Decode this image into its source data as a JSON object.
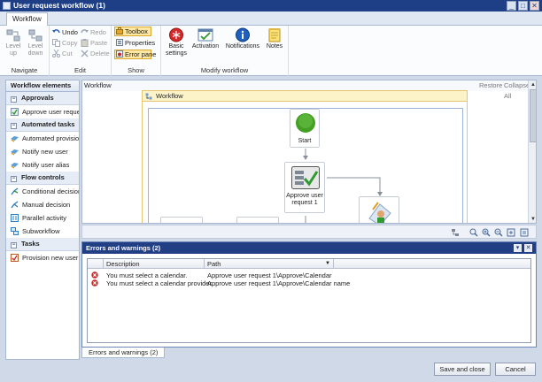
{
  "window": {
    "title": "User request workflow (1)",
    "minimize": "_",
    "maximize": "□",
    "close": "✕"
  },
  "ribbon": {
    "tab": "Workflow",
    "navigate": {
      "label": "Navigate",
      "level_up": "Level up",
      "level_down": "Level down"
    },
    "edit": {
      "label": "Edit",
      "undo": "Undo",
      "redo": "Redo",
      "copy": "Copy",
      "paste": "Paste",
      "cut": "Cut",
      "delete": "Delete"
    },
    "show": {
      "label": "Show",
      "toolbox": "Toolbox",
      "properties": "Properties",
      "error_pane": "Error pane"
    },
    "modify": {
      "label": "Modify workflow",
      "basic_settings": "Basic settings",
      "activation": "Activation",
      "notifications": "Notifications",
      "notes": "Notes"
    }
  },
  "toolbox": {
    "title": "Workflow elements",
    "categories": [
      {
        "name": "Approvals",
        "items": [
          "Approve user request"
        ]
      },
      {
        "name": "Automated tasks",
        "items": [
          "Automated provision",
          "Notify new user",
          "Notify user alias"
        ]
      },
      {
        "name": "Flow controls",
        "items": [
          "Conditional decision",
          "Manual decision",
          "Parallel activity",
          "Subworkflow"
        ]
      },
      {
        "name": "Tasks",
        "items": [
          "Provision new user"
        ]
      }
    ]
  },
  "designer": {
    "label": "Workflow",
    "restore": "Restore",
    "collapse_all": "Collapse All",
    "workflow_title": "Workflow",
    "nodes": {
      "start": "Start",
      "approve": "Approve user request 1"
    }
  },
  "errors": {
    "title": "Errors and warnings (2)",
    "columns": [
      "Description",
      "Path"
    ],
    "rows": [
      {
        "description": "You must select a calendar.",
        "path": "Approve user request 1\\Approve\\Calendar"
      },
      {
        "description": "You must select a calendar provider.",
        "path": "Approve user request 1\\Approve\\Calendar name"
      }
    ],
    "tab": "Errors and warnings (2)"
  },
  "footer": {
    "save_close": "Save and close",
    "cancel": "Cancel"
  },
  "colors": {
    "titlebar": "#1e3f86",
    "accent": "#fde7a2",
    "error": "#c62828",
    "start": "#43a022"
  }
}
